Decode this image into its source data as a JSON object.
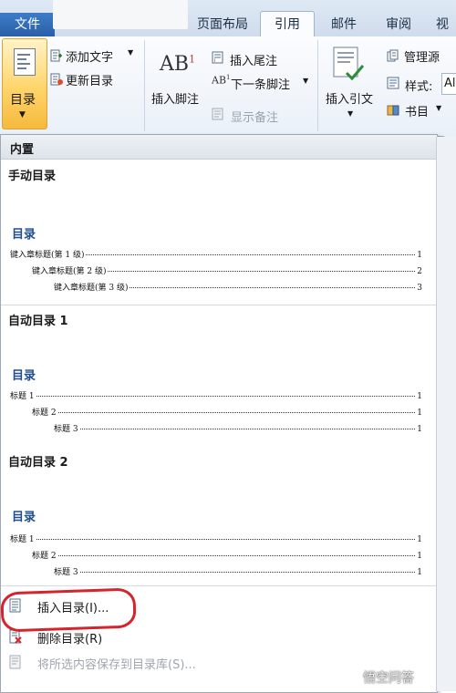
{
  "tabs": {
    "file": "文件",
    "page_layout": "页面布局",
    "references": "引用",
    "mailings": "邮件",
    "review": "审阅",
    "view": "视"
  },
  "ribbon": {
    "toc_button": "目录",
    "add_text": "添加文字",
    "update_toc": "更新目录",
    "insert_footnote": "插入脚注",
    "insert_endnote": "插入尾注",
    "next_footnote": "下一条脚注",
    "show_notes": "显示备注",
    "insert_citation": "插入引文",
    "manage_sources": "管理源",
    "style_label": "样式:",
    "style_value": "Al",
    "bibliography": "书目",
    "group_tail": "目"
  },
  "panel": {
    "section_header": "内置",
    "items": [
      {
        "title": "手动目录",
        "heading": "目录",
        "lines": [
          {
            "label": "键入章标题(第 1 级)",
            "page": "1"
          },
          {
            "label": "键入章标题(第 2 级)",
            "page": "2"
          },
          {
            "label": "键入章标题(第 3 级)",
            "page": "3"
          }
        ]
      },
      {
        "title": "自动目录 1",
        "heading": "目录",
        "lines": [
          {
            "label": "标题 1",
            "page": "1"
          },
          {
            "label": "标题 2",
            "page": "1"
          },
          {
            "label": "标题 3",
            "page": "1"
          }
        ]
      },
      {
        "title": "自动目录 2",
        "heading": "目录",
        "lines": [
          {
            "label": "标题 1",
            "page": "1"
          },
          {
            "label": "标题 2",
            "page": "1"
          },
          {
            "label": "标题 3",
            "page": "1"
          }
        ]
      }
    ],
    "commands": {
      "insert_toc": "插入目录(I)...",
      "delete_toc": "删除目录(R)",
      "save_selection": "将所选内容保存到目录库(S)..."
    }
  },
  "watermark": "悟空问答",
  "colors": {
    "accent_blue": "#1f4e8c",
    "highlight_red": "#d3252b",
    "toc_button_gold": "#ffd56b"
  }
}
